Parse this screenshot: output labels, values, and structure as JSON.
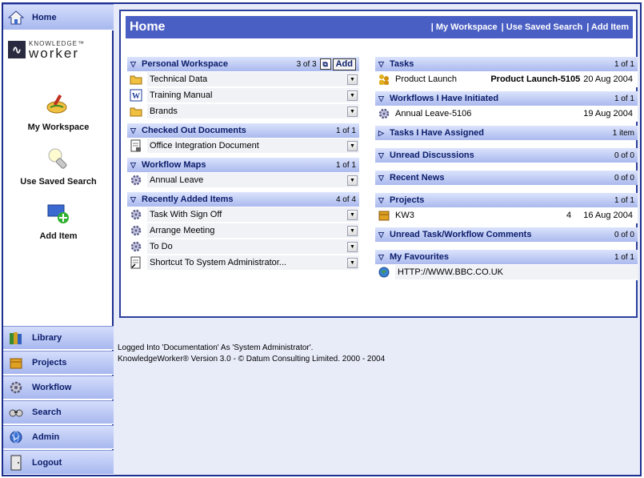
{
  "nav": {
    "home": "Home",
    "library": "Library",
    "projects": "Projects",
    "workflow": "Workflow",
    "search": "Search",
    "admin": "Admin",
    "logout": "Logout"
  },
  "logo": {
    "line1": "KNOWLEDGE™",
    "line2": "worker"
  },
  "shortcuts": {
    "workspace": "My Workspace",
    "saved_search": "Use Saved Search",
    "add_item": "Add Item"
  },
  "header": {
    "title": "Home",
    "links": [
      "| My Workspace",
      "| Use Saved Search",
      "| Add Item"
    ]
  },
  "left_sections": {
    "personal": {
      "title": "Personal Workspace",
      "count": "3 of 3",
      "add_label": "Add",
      "items": [
        "Technical Data",
        "Training Manual",
        "Brands"
      ]
    },
    "checked_out": {
      "title": "Checked Out Documents",
      "count": "1 of 1",
      "items": [
        "Office Integration Document"
      ]
    },
    "workflow_maps": {
      "title": "Workflow Maps",
      "count": "1 of 1",
      "items": [
        "Annual Leave"
      ]
    },
    "recent_items": {
      "title": "Recently Added Items",
      "count": "4 of 4",
      "items": [
        "Task With Sign Off",
        "Arrange Meeting",
        "To Do",
        "Shortcut To System Administrator..."
      ]
    }
  },
  "right_sections": {
    "tasks": {
      "title": "Tasks",
      "count": "1 of 1",
      "row": {
        "name": "Product Launch",
        "ref": "Product Launch-5105",
        "date": "20 Aug 2004"
      }
    },
    "workflows_initiated": {
      "title": "Workflows I Have Initiated",
      "count": "1 of 1",
      "row": {
        "name": "Annual Leave-5106",
        "date": "19 Aug 2004"
      }
    },
    "tasks_assigned": {
      "title": "Tasks I Have Assigned",
      "count": "1 item"
    },
    "unread_discussions": {
      "title": "Unread Discussions",
      "count": "0 of 0"
    },
    "recent_news": {
      "title": "Recent News",
      "count": "0 of 0"
    },
    "projects": {
      "title": "Projects",
      "count": "1 of 1",
      "row": {
        "name": "KW3",
        "num": "4",
        "date": "16 Aug 2004"
      }
    },
    "unread_comments": {
      "title": "Unread Task/Workflow Comments",
      "count": "0 of 0"
    },
    "favourites": {
      "title": "My Favourites",
      "count": "1 of 1",
      "row": {
        "name": "HTTP://WWW.BBC.CO.UK"
      }
    }
  },
  "footer": {
    "line1": "Logged Into 'Documentation' As 'System Administrator'.",
    "line2": "KnowledgeWorker® Version 3.0 - © Datum Consulting Limited. 2000 - 2004"
  }
}
